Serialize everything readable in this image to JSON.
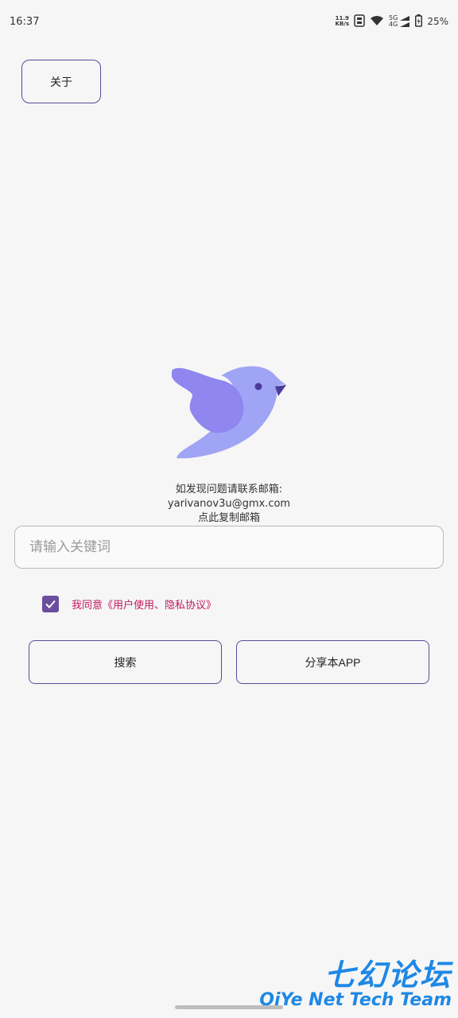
{
  "status_bar": {
    "time": "16:37",
    "net_speed_value": "11.9",
    "net_speed_unit": "KB/s",
    "signal_5g": "5G",
    "signal_4g": "4G",
    "battery": "25%"
  },
  "about_button": "关于",
  "contact": {
    "line1": "如发现问题请联系邮箱:",
    "email": "yarivanov3u@gmx.com",
    "copy_hint": "点此复制邮箱"
  },
  "search": {
    "placeholder": "请输入关键词",
    "value": ""
  },
  "agreement": {
    "checked": true,
    "text": "我同意《用户使用、隐私协议》"
  },
  "buttons": {
    "search": "搜索",
    "share": "分享本APP"
  },
  "watermark": {
    "cn": "七幻论坛",
    "en": "QiYe Net Tech Team"
  },
  "colors": {
    "accent": "#6a4fa0",
    "agreement_text": "#c2185b",
    "bird_body": "#a0a4f4",
    "bird_wing": "#8f86f0",
    "watermark": "#1e88e5"
  }
}
